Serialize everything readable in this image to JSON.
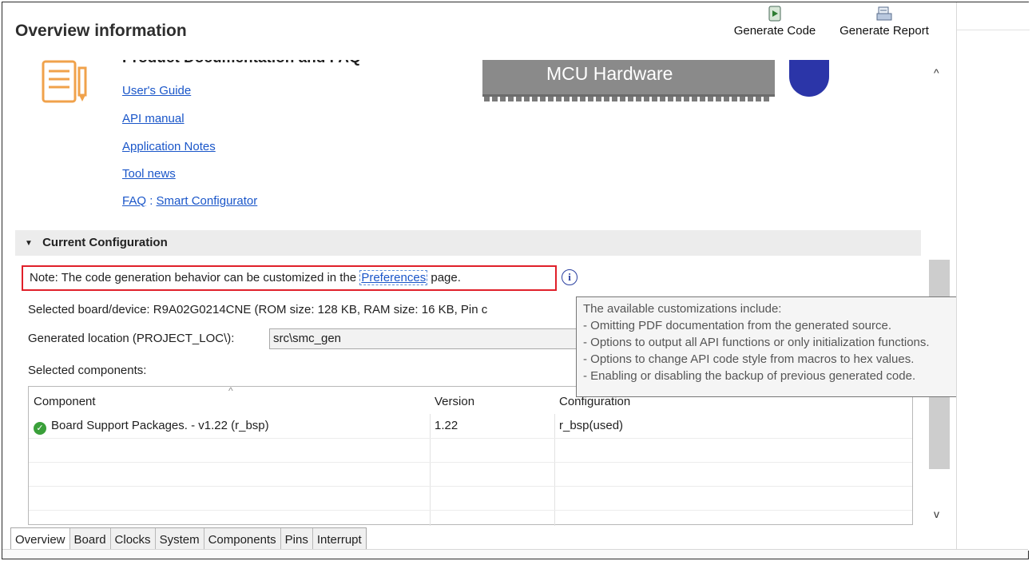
{
  "title": "Overview information",
  "toolbar": {
    "generate_code": "Generate Code",
    "generate_report": "Generate Report"
  },
  "documentation": {
    "heading": "Product Documentation and FAQ",
    "links": [
      "User's Guide",
      "API manual",
      "Application Notes",
      "Tool news"
    ],
    "faq_label": "FAQ",
    "faq_separator": ":",
    "faq_link": "Smart Configurator"
  },
  "diagram": {
    "mcu_label": "MCU Hardware"
  },
  "current_config": {
    "section_title": "Current Configuration",
    "note_prefix": "Note: The code generation behavior can be customized in the ",
    "note_link": "Preferences",
    "note_suffix": " page.",
    "selected_board": "Selected board/device: R9A02G0214CNE (ROM size: 128 KB, RAM size: 16 KB, Pin c",
    "generated_location_label": "Generated location (PROJECT_LOC\\):",
    "generated_location_value": "src\\smc_gen",
    "selected_components_label": "Selected components:"
  },
  "table": {
    "headers": [
      "Component",
      "Version",
      "Configuration"
    ],
    "rows": [
      {
        "component": "Board Support Packages. - v1.22 (r_bsp)",
        "version": "1.22",
        "configuration": "r_bsp(used)"
      }
    ]
  },
  "tooltip": {
    "lines": [
      "The available customizations include:",
      "- Omitting PDF documentation from the generated source.",
      "- Options to output all API functions or only initialization functions.",
      "- Options to change API code style from macros to hex values.",
      "- Enabling or disabling the backup of previous generated code."
    ]
  },
  "tabs": [
    "Overview",
    "Board",
    "Clocks",
    "System",
    "Components",
    "Pins",
    "Interrupt"
  ],
  "active_tab": "Overview",
  "icons": {
    "generate_code": "generate-code-icon",
    "generate_report": "generate-report-icon",
    "document": "document-icon",
    "info": "info-icon",
    "status_ok": "check-circle-icon"
  },
  "colors": {
    "link": "#1a56c9",
    "highlight_border": "#e0202a",
    "mcu_chip": "#8a8a8a",
    "blob": "#2b35a8",
    "ok": "#3aa03a"
  }
}
